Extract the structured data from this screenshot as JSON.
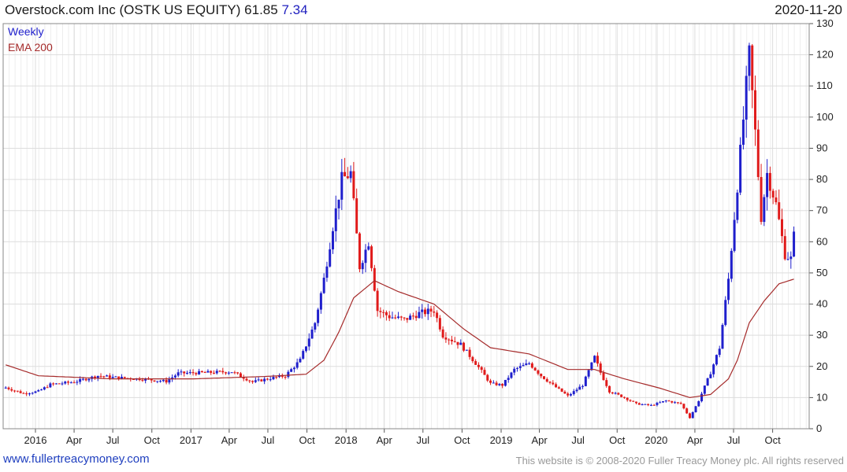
{
  "header": {
    "title": "Overstock.com Inc (OSTK US EQUITY) 61.85",
    "change": "7.34",
    "date": "2020-11-20"
  },
  "legend": {
    "series1": "Weekly",
    "series2": "EMA 200"
  },
  "footer": {
    "left": "www.fullertreacymoney.com",
    "right": "This website is © 2008-2020 Fuller Treacy Money plc. All rights reserved"
  },
  "colors": {
    "up": "#1f1fcc",
    "down": "#e01b1b",
    "ema": "#a52a2a",
    "grid": "#dddddd"
  },
  "chart_data": {
    "type": "candlestick",
    "ylim": [
      0,
      130
    ],
    "yticks": [
      0,
      10,
      20,
      30,
      40,
      50,
      60,
      70,
      80,
      90,
      100,
      110,
      120,
      130
    ],
    "xticks": [
      {
        "label": "2016",
        "date": "2016-01-01"
      },
      {
        "label": "Apr",
        "date": "2016-04-01"
      },
      {
        "label": "Jul",
        "date": "2016-07-01"
      },
      {
        "label": "Oct",
        "date": "2016-10-01"
      },
      {
        "label": "2017",
        "date": "2017-01-01"
      },
      {
        "label": "Apr",
        "date": "2017-04-01"
      },
      {
        "label": "Jul",
        "date": "2017-07-01"
      },
      {
        "label": "Oct",
        "date": "2017-10-01"
      },
      {
        "label": "2018",
        "date": "2018-01-01"
      },
      {
        "label": "Apr",
        "date": "2018-04-01"
      },
      {
        "label": "Jul",
        "date": "2018-07-01"
      },
      {
        "label": "Oct",
        "date": "2018-10-01"
      },
      {
        "label": "2019",
        "date": "2019-01-01"
      },
      {
        "label": "Apr",
        "date": "2019-04-01"
      },
      {
        "label": "Jul",
        "date": "2019-07-01"
      },
      {
        "label": "Oct",
        "date": "2019-10-01"
      },
      {
        "label": "2020",
        "date": "2020-01-01"
      },
      {
        "label": "Apr",
        "date": "2020-04-01"
      },
      {
        "label": "Jul",
        "date": "2020-07-01"
      },
      {
        "label": "Oct",
        "date": "2020-10-01"
      }
    ],
    "x_start": "2015-10-17",
    "x_end": "2020-12-26",
    "close_series": [
      {
        "date": "2015-10-23",
        "value": 13.2
      },
      {
        "date": "2015-12-04",
        "value": 11.3
      },
      {
        "date": "2016-01-08",
        "value": 12.0
      },
      {
        "date": "2016-02-05",
        "value": 14.2
      },
      {
        "date": "2016-04-01",
        "value": 15.0
      },
      {
        "date": "2016-05-27",
        "value": 17.0
      },
      {
        "date": "2016-07-01",
        "value": 16.5
      },
      {
        "date": "2016-09-02",
        "value": 16.0
      },
      {
        "date": "2016-11-04",
        "value": 15.2
      },
      {
        "date": "2016-12-02",
        "value": 17.8
      },
      {
        "date": "2017-02-03",
        "value": 18.0
      },
      {
        "date": "2017-04-07",
        "value": 18.3
      },
      {
        "date": "2017-05-26",
        "value": 15.0
      },
      {
        "date": "2017-07-07",
        "value": 16.2
      },
      {
        "date": "2017-08-11",
        "value": 17.0
      },
      {
        "date": "2017-09-15",
        "value": 22.0
      },
      {
        "date": "2017-10-20",
        "value": 34.0
      },
      {
        "date": "2017-11-10",
        "value": 48.0
      },
      {
        "date": "2017-12-01",
        "value": 65.0
      },
      {
        "date": "2017-12-22",
        "value": 80.0
      },
      {
        "date": "2018-01-12",
        "value": 82.0
      },
      {
        "date": "2018-02-02",
        "value": 52.0
      },
      {
        "date": "2018-02-23",
        "value": 60.0
      },
      {
        "date": "2018-03-16",
        "value": 38.0
      },
      {
        "date": "2018-04-13",
        "value": 36.0
      },
      {
        "date": "2018-05-18",
        "value": 35.0
      },
      {
        "date": "2018-06-22",
        "value": 37.0
      },
      {
        "date": "2018-07-27",
        "value": 38.0
      },
      {
        "date": "2018-08-17",
        "value": 30.0
      },
      {
        "date": "2018-09-28",
        "value": 27.0
      },
      {
        "date": "2018-11-02",
        "value": 21.0
      },
      {
        "date": "2018-12-07",
        "value": 14.5
      },
      {
        "date": "2019-01-04",
        "value": 14.0
      },
      {
        "date": "2019-02-01",
        "value": 19.0
      },
      {
        "date": "2019-03-08",
        "value": 21.0
      },
      {
        "date": "2019-04-05",
        "value": 17.0
      },
      {
        "date": "2019-05-03",
        "value": 14.0
      },
      {
        "date": "2019-06-07",
        "value": 10.5
      },
      {
        "date": "2019-07-12",
        "value": 14.0
      },
      {
        "date": "2019-08-09",
        "value": 23.0
      },
      {
        "date": "2019-08-23",
        "value": 18.0
      },
      {
        "date": "2019-09-13",
        "value": 12.0
      },
      {
        "date": "2019-10-18",
        "value": 10.0
      },
      {
        "date": "2019-11-15",
        "value": 8.0
      },
      {
        "date": "2019-12-20",
        "value": 7.5
      },
      {
        "date": "2020-01-24",
        "value": 9.0
      },
      {
        "date": "2020-02-28",
        "value": 8.0
      },
      {
        "date": "2020-03-20",
        "value": 3.5
      },
      {
        "date": "2020-04-10",
        "value": 9.0
      },
      {
        "date": "2020-05-08",
        "value": 18.0
      },
      {
        "date": "2020-05-29",
        "value": 26.0
      },
      {
        "date": "2020-06-19",
        "value": 48.0
      },
      {
        "date": "2020-07-10",
        "value": 78.0
      },
      {
        "date": "2020-07-31",
        "value": 110.0
      },
      {
        "date": "2020-08-07",
        "value": 120.0
      },
      {
        "date": "2020-08-21",
        "value": 95.0
      },
      {
        "date": "2020-09-04",
        "value": 68.0
      },
      {
        "date": "2020-09-18",
        "value": 82.0
      },
      {
        "date": "2020-10-09",
        "value": 72.0
      },
      {
        "date": "2020-10-30",
        "value": 56.0
      },
      {
        "date": "2020-11-13",
        "value": 54.5
      },
      {
        "date": "2020-11-20",
        "value": 61.85
      }
    ],
    "ema_200": [
      {
        "date": "2015-10-23",
        "value": 20.5
      },
      {
        "date": "2016-01-08",
        "value": 17.0
      },
      {
        "date": "2016-07-01",
        "value": 16.0
      },
      {
        "date": "2017-01-06",
        "value": 16.0
      },
      {
        "date": "2017-06-30",
        "value": 16.8
      },
      {
        "date": "2017-09-29",
        "value": 17.5
      },
      {
        "date": "2017-11-10",
        "value": 22.0
      },
      {
        "date": "2017-12-15",
        "value": 31.0
      },
      {
        "date": "2018-01-19",
        "value": 42.0
      },
      {
        "date": "2018-03-09",
        "value": 47.5
      },
      {
        "date": "2018-05-04",
        "value": 44.0
      },
      {
        "date": "2018-07-27",
        "value": 40.0
      },
      {
        "date": "2018-10-05",
        "value": 32.0
      },
      {
        "date": "2018-12-07",
        "value": 26.0
      },
      {
        "date": "2019-03-08",
        "value": 24.0
      },
      {
        "date": "2019-06-07",
        "value": 19.0
      },
      {
        "date": "2019-08-09",
        "value": 19.0
      },
      {
        "date": "2019-10-18",
        "value": 16.0
      },
      {
        "date": "2020-01-10",
        "value": 13.0
      },
      {
        "date": "2020-03-20",
        "value": 10.0
      },
      {
        "date": "2020-05-08",
        "value": 11.0
      },
      {
        "date": "2020-06-19",
        "value": 16.0
      },
      {
        "date": "2020-07-10",
        "value": 22.0
      },
      {
        "date": "2020-08-07",
        "value": 34.0
      },
      {
        "date": "2020-09-11",
        "value": 41.0
      },
      {
        "date": "2020-10-16",
        "value": 46.5
      },
      {
        "date": "2020-11-20",
        "value": 48.0
      }
    ]
  }
}
